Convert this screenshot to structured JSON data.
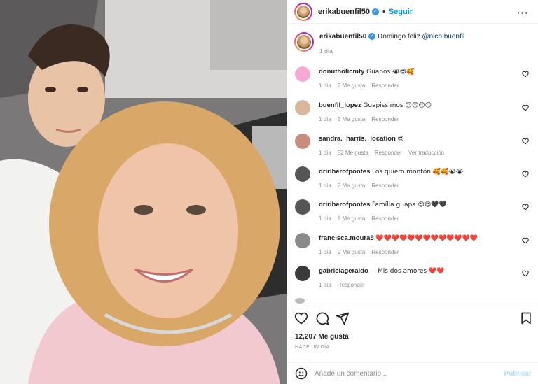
{
  "post": {
    "username": "erikabuenfil50",
    "follow_label": "Seguir",
    "more_icon": "more-horizontal-icon",
    "caption_text": "Domingo feliz",
    "caption_mention": "@nico.buenfil",
    "caption_time": "1 día",
    "likes": "12,207 Me gusta",
    "time_ago": "HACE UN DÍA"
  },
  "comments": [
    {
      "user": "donutholicmty",
      "text": "Guapos 😭😍🥰",
      "time": "1 día",
      "likes": "2 Me gusta",
      "reply": "Responder",
      "translate": "",
      "avatar_color": "#f7a9d6"
    },
    {
      "user": "buenfil_lopez",
      "text": "Guapissimos 😍😍😍😍",
      "time": "1 día",
      "likes": "2 Me gusta",
      "reply": "Responder",
      "translate": "",
      "avatar_color": "#d9b79a"
    },
    {
      "user": "sandra._harris._location",
      "text": "😍",
      "time": "1 día",
      "likes": "52 Me gusta",
      "reply": "Responder",
      "translate": "Ver traducción",
      "avatar_color": "#c98b7a"
    },
    {
      "user": "dririberofpontes",
      "text": "Los quiero montón 🥰🥰😭😭",
      "time": "1 día",
      "likes": "2 Me gusta",
      "reply": "Responder",
      "translate": "",
      "avatar_color": "#555555"
    },
    {
      "user": "dririberofpontes",
      "text": "Família guapa 😍😍🖤🖤",
      "time": "1 día",
      "likes": "1 Me gusta",
      "reply": "Responder",
      "translate": "",
      "avatar_color": "#555555"
    },
    {
      "user": "francisca.moura5",
      "text": "❤️❤️❤️❤️❤️❤️❤️❤️❤️❤️❤️❤️❤️",
      "time": "1 día",
      "likes": "2 Me gusta",
      "reply": "Responder",
      "translate": "",
      "avatar_color": "#8a8a8a"
    },
    {
      "user": "gabrielageraldo__",
      "text": "Mis dos amores ❤️❤️",
      "time": "1 día",
      "likes": "",
      "reply": "Responder",
      "translate": "",
      "avatar_color": "#3a3a3a"
    }
  ],
  "composer": {
    "placeholder": "Añade un comentario...",
    "publish_label": "Publicar",
    "emoji_icon": "smiley-icon"
  },
  "colors": {
    "accent": "#0095f6",
    "verified": "#3897f0",
    "muted": "#8e8e8e"
  }
}
